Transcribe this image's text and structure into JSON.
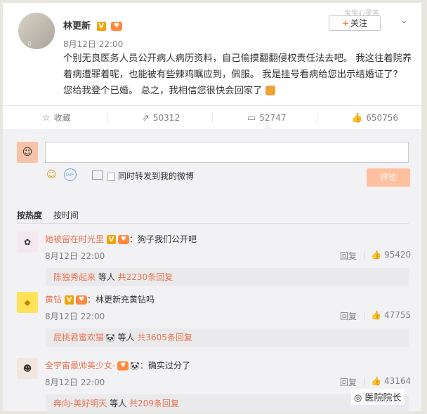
{
  "post": {
    "author": "林更新",
    "author_badge": "V",
    "time": "8月12日 22:00",
    "follow_label": "关注",
    "follow_plus": "+",
    "watermark": "宝宝心里苦",
    "content": "个别无良医务人员公开病人病历资料，自己偷摸翻翻侵权责任法去吧。 我这往着院养着病遭罪着呢，也能被有些辣鸡瞩应到，佩服。 我是挂号看病给您出示结婚证了？ 您给我登个已婚。 总之，我相信您很快会回家了"
  },
  "actions": {
    "favorite": "收藏",
    "repost_count": "50312",
    "comment_count": "52747",
    "like_count": "650756"
  },
  "compose": {
    "repost_label": "同时转发到我的微博",
    "submit_label": "评论"
  },
  "sort": {
    "by_hot": "按热度",
    "by_time": "按时间"
  },
  "comments": [
    {
      "user": "她被留在时光里",
      "text": "：狗子我们公开吧",
      "time": "8月12日 22:00",
      "reply": "回复",
      "likes": "95420",
      "sub_user": "陈独秀起来",
      "sub_mid": " 等人 ",
      "sub_count": "共2230条回复"
    },
    {
      "user": "黄钻",
      "text": "：林更新充黄钻吗",
      "time": "8月12日 22:00",
      "reply": "回复",
      "likes": "47755",
      "sub_user": "屁桃君蜜欢猫",
      "sub_mid": " 等人 ",
      "sub_count": "共3605条回复"
    },
    {
      "user": "全宇宙最帅美少女-",
      "text": "：确实过分了",
      "time": "8月12日 22:00",
      "reply": "回复",
      "likes": "43164",
      "sub_user": "奔向-美好明天",
      "sub_mid": " 等人 ",
      "sub_count": "共209条回复"
    }
  ],
  "brand_watermark": "医院院长"
}
